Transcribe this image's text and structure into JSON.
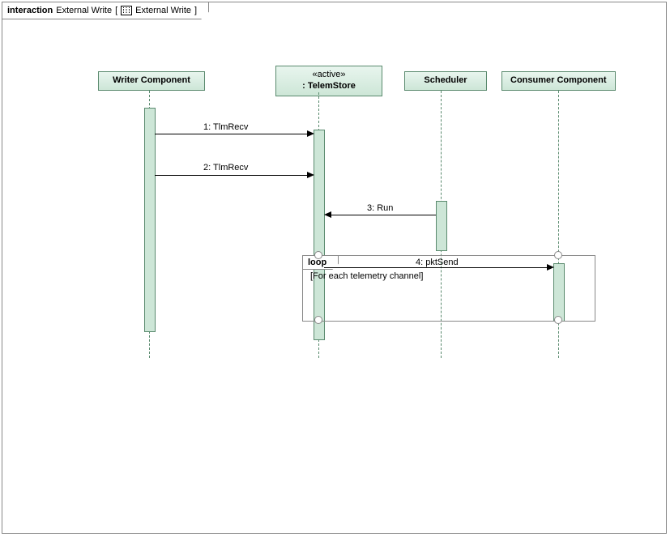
{
  "header": {
    "keyword": "interaction",
    "title": "External Write",
    "bracket_open": "[",
    "bracket_inner": "External Write",
    "bracket_close": "]"
  },
  "lifelines": {
    "writer": {
      "label": "Writer Component"
    },
    "telem": {
      "stereo": "«active»",
      "label": ": TelemStore"
    },
    "scheduler": {
      "label": "Scheduler"
    },
    "consumer": {
      "label": "Consumer Component"
    }
  },
  "messages": {
    "m1": "1: TlmRecv",
    "m2": "2: TlmRecv",
    "m3": "3: Run",
    "m4": "4: pktSend"
  },
  "fragment": {
    "operator": "loop",
    "guard": "[For each telemetry channel]"
  }
}
